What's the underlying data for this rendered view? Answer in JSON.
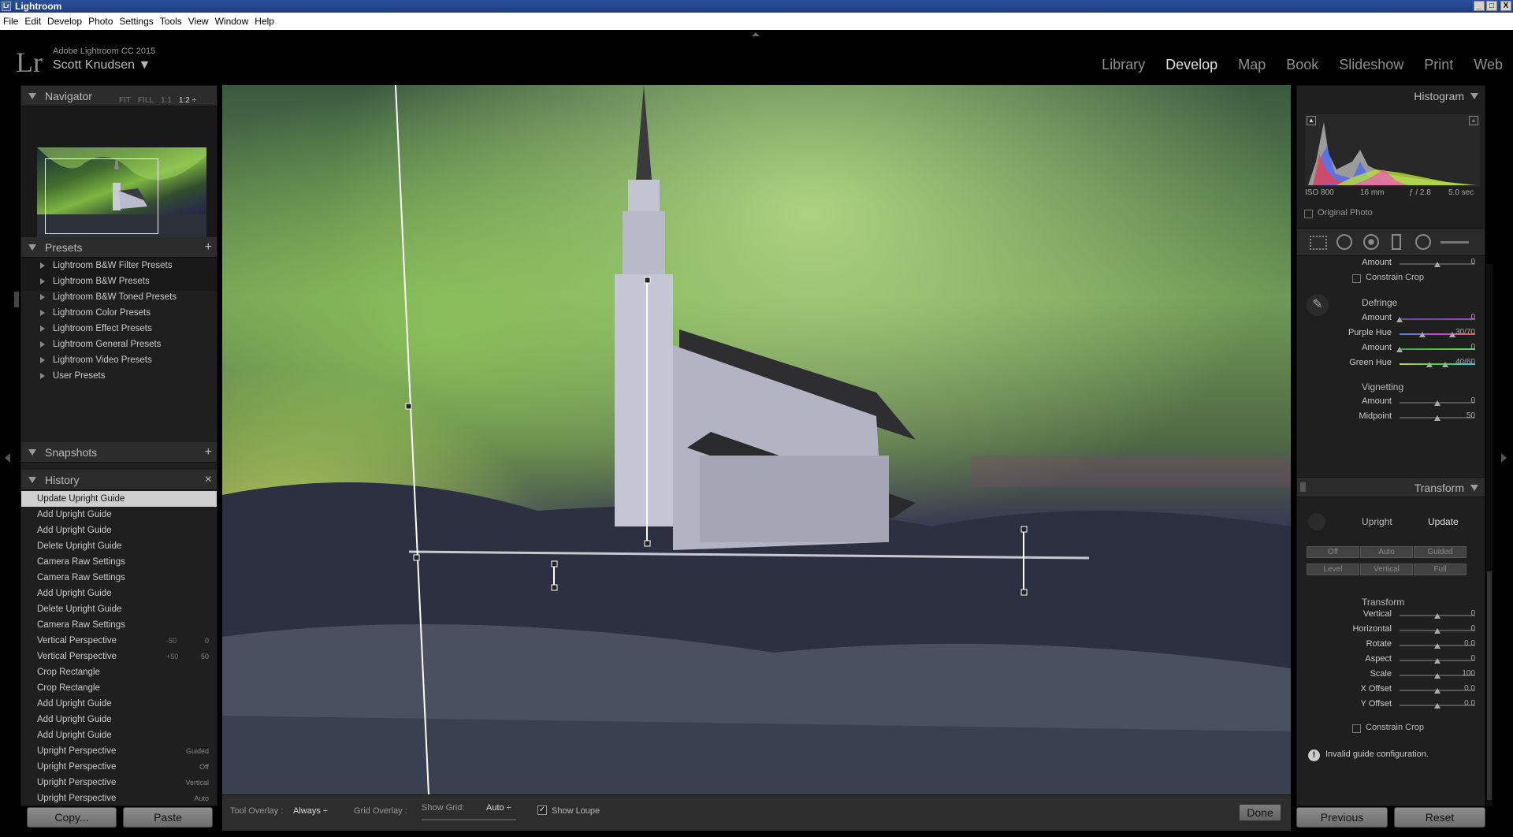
{
  "window": {
    "title": "Lightroom",
    "icon_text": "Lr",
    "minimize": "_",
    "maximize": "□",
    "close": "X"
  },
  "menubar": [
    "File",
    "Edit",
    "Develop",
    "Photo",
    "Settings",
    "Tools",
    "View",
    "Window",
    "Help"
  ],
  "identity": {
    "logo": "Lr",
    "app_version": "Adobe Lightroom CC 2015",
    "user": "Scott Knudsen ▼"
  },
  "modules": [
    "Library",
    "Develop",
    "Map",
    "Book",
    "Slideshow",
    "Print",
    "Web"
  ],
  "active_module": "Develop",
  "navigator": {
    "title": "Navigator",
    "views": [
      "FIT",
      "FILL",
      "1:1",
      "1:2 ÷"
    ],
    "selected_view": "1:2 ÷"
  },
  "presets": {
    "title": "Presets",
    "add": "+",
    "items": [
      "Lightroom B&W Filter Presets",
      "Lightroom B&W Presets",
      "Lightroom B&W Toned Presets",
      "Lightroom Color Presets",
      "Lightroom Effect Presets",
      "Lightroom General Presets",
      "Lightroom Video Presets",
      "User Presets"
    ]
  },
  "snapshots": {
    "title": "Snapshots",
    "add": "+"
  },
  "history": {
    "title": "History",
    "clear": "×",
    "selected_index": 0,
    "items": [
      {
        "label": "Update Upright Guide",
        "before": "",
        "after": ""
      },
      {
        "label": "Add Upright Guide",
        "before": "",
        "after": ""
      },
      {
        "label": "Add Upright Guide",
        "before": "",
        "after": ""
      },
      {
        "label": "Delete Upright Guide",
        "before": "",
        "after": ""
      },
      {
        "label": "Camera Raw Settings",
        "before": "",
        "after": ""
      },
      {
        "label": "Camera Raw Settings",
        "before": "",
        "after": ""
      },
      {
        "label": "Add Upright Guide",
        "before": "",
        "after": ""
      },
      {
        "label": "Delete Upright Guide",
        "before": "",
        "after": ""
      },
      {
        "label": "Camera Raw Settings",
        "before": "",
        "after": ""
      },
      {
        "label": "Vertical Perspective",
        "before": "-50",
        "after": "0"
      },
      {
        "label": "Vertical Perspective",
        "before": "+50",
        "after": "50"
      },
      {
        "label": "Crop Rectangle",
        "before": "",
        "after": ""
      },
      {
        "label": "Crop Rectangle",
        "before": "",
        "after": ""
      },
      {
        "label": "Add Upright Guide",
        "before": "",
        "after": ""
      },
      {
        "label": "Add Upright Guide",
        "before": "",
        "after": ""
      },
      {
        "label": "Add Upright Guide",
        "before": "",
        "after": ""
      },
      {
        "label": "Upright Perspective",
        "before": "",
        "after": "Guided"
      },
      {
        "label": "Upright Perspective",
        "before": "",
        "after": "Off"
      },
      {
        "label": "Upright Perspective",
        "before": "",
        "after": "Vertical"
      },
      {
        "label": "Upright Perspective",
        "before": "",
        "after": "Auto"
      }
    ]
  },
  "left_buttons": {
    "copy": "Copy...",
    "paste": "Paste"
  },
  "toolbar": {
    "tool_overlay_label": "Tool Overlay :",
    "tool_overlay_value": "Always ÷",
    "grid_overlay_label": "Grid Overlay :",
    "show_grid_label": "Show Grid:",
    "show_grid_value": "Auto ÷",
    "show_loupe_label": "Show Loupe",
    "show_loupe_checked": "✓",
    "done": "Done"
  },
  "histogram": {
    "title": "Histogram",
    "iso": "ISO 800",
    "focal": "16 mm",
    "aperture": "ƒ / 2.8",
    "shutter": "5.0 sec",
    "original_photo": "Original Photo"
  },
  "lens_corrections": {
    "amount_label": "Amount",
    "amount_value": "0",
    "amount_level": 0.5,
    "constrain_crop": "Constrain Crop",
    "defringe_title": "Defringe",
    "defringe_sliders": [
      {
        "label": "Amount",
        "value": "0",
        "level": 0.0
      },
      {
        "label": "Purple Hue",
        "value": "30/70",
        "level": 0.3,
        "level2": 0.7
      },
      {
        "label": "Amount",
        "value": "0",
        "level": 0.0
      },
      {
        "label": "Green Hue",
        "value": "40/60",
        "level": 0.4,
        "level2": 0.6
      }
    ],
    "vignetting_title": "Vignetting",
    "vignetting_sliders": [
      {
        "label": "Amount",
        "value": "0",
        "level": 0.5
      },
      {
        "label": "Midpoint",
        "value": "50",
        "level": 0.5
      }
    ]
  },
  "transform": {
    "title": "Transform",
    "upright_label": "Upright",
    "update_label": "Update",
    "upright_buttons": [
      "Off",
      "Auto",
      "Guided",
      "Level",
      "Vertical",
      "Full"
    ],
    "section_title": "Transform",
    "sliders": [
      {
        "label": "Vertical",
        "value": "0",
        "level": 0.5
      },
      {
        "label": "Horizontal",
        "value": "0",
        "level": 0.5
      },
      {
        "label": "Rotate",
        "value": "0.0",
        "level": 0.5
      },
      {
        "label": "Aspect",
        "value": "0",
        "level": 0.5
      },
      {
        "label": "Scale",
        "value": "100",
        "level": 0.5
      },
      {
        "label": "X Offset",
        "value": "0.0",
        "level": 0.5
      },
      {
        "label": "Y Offset",
        "value": "0.0",
        "level": 0.5
      }
    ],
    "constrain_crop": "Constrain Crop",
    "warning_icon": "!",
    "warning": "Invalid guide configuration."
  },
  "right_buttons": {
    "previous": "Previous",
    "reset": "Reset"
  },
  "colors": {
    "panel_bg": "#1f1f1f",
    "header_bg": "#2c2c2c",
    "aurora_green": "#8fc44f",
    "selected_history": "#cfcfcf"
  }
}
